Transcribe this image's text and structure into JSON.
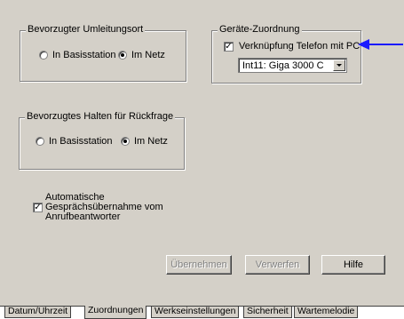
{
  "redirect_group": {
    "title": "Bevorzugter Umleitungsort",
    "options": [
      "In Basisstation",
      "Im Netz"
    ],
    "selected": "Im Netz"
  },
  "device_group": {
    "title": "Geräte-Zuordnung",
    "checkbox_label": "Verknüpfung Telefon mit PC",
    "checkbox_checked": true,
    "device_select_value": "Int11:  Giga 3000 C"
  },
  "hold_group": {
    "title": "Bevorzugtes Halten für Rückfrage",
    "options": [
      "In Basisstation",
      "Im Netz"
    ],
    "selected": "Im Netz"
  },
  "auto_answer": {
    "line1": "Automatische",
    "line2": "Gesprächsübernahme vom",
    "line3": "Anrufbeantworter",
    "checked": true
  },
  "buttons": {
    "apply": "Übernehmen",
    "discard": "Verwerfen",
    "help": "Hilfe"
  },
  "tabs": [
    "Datum/Uhrzeit",
    "Zuordnungen",
    "Werkseinstellungen",
    "Sicherheit",
    "Wartemelodie"
  ],
  "active_tab": "Zuordnungen",
  "colors": {
    "annotation_arrow": "#1a1aff",
    "panel": "#d4d0c8"
  }
}
